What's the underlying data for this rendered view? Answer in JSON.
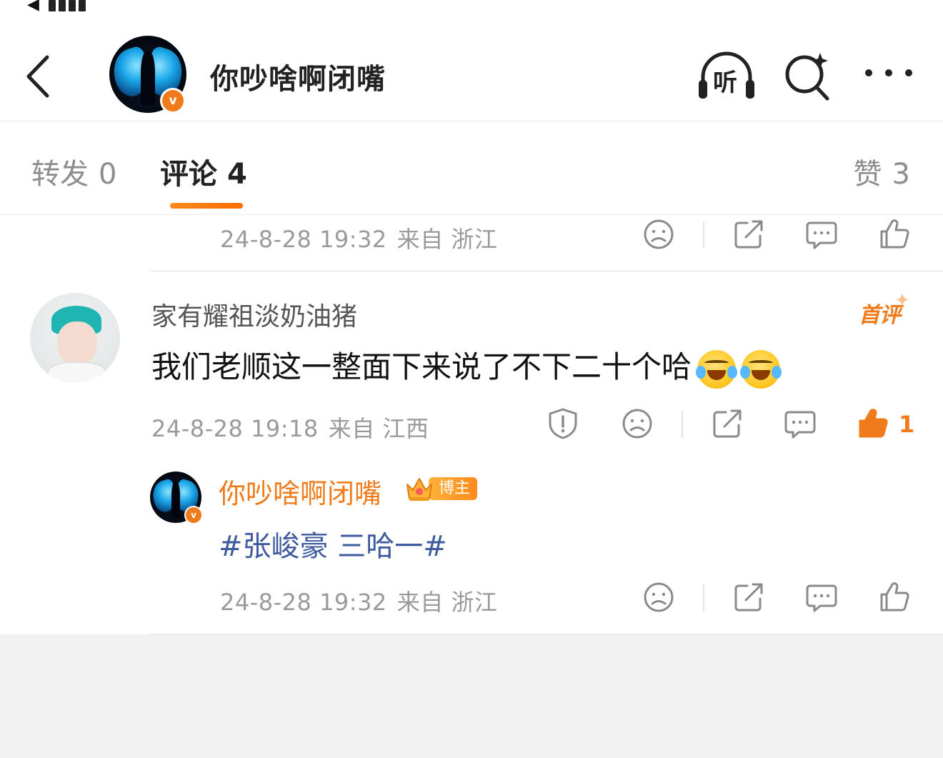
{
  "header": {
    "title": "你吵啥啊闭嘴",
    "listen_label": "听",
    "verified_mark": "v"
  },
  "tabs": {
    "repost": {
      "label": "转发",
      "count": "0"
    },
    "comment": {
      "label": "评论",
      "count": "4"
    },
    "like": {
      "label": "赞",
      "count": "3"
    }
  },
  "prev_reply": {
    "date": "24-8-28 19:32",
    "source": "来自 浙江"
  },
  "comment": {
    "username": "家有耀祖淡奶油猪",
    "first_badge": "首评",
    "text": "我们老顺这一整面下来说了不下二十个哈",
    "date": "24-8-28 19:18",
    "source": "来自 江西",
    "like_count": "1"
  },
  "reply": {
    "username": "你吵啥啊闭嘴",
    "badge": "博主",
    "text": "#张峻豪 三哈一#",
    "date": "24-8-28 19:32",
    "source": "来自 浙江"
  },
  "colors": {
    "accent": "#f07b1b",
    "topic_link": "#3e5a9e",
    "meta_gray": "#9a9a9a"
  },
  "icons": [
    "back-icon",
    "headphone-icon",
    "search-icon",
    "more-icon",
    "dislike-icon",
    "share-icon",
    "comment-icon",
    "like-icon",
    "report-icon",
    "crown-icon",
    "laugh-cry-emoji"
  ]
}
